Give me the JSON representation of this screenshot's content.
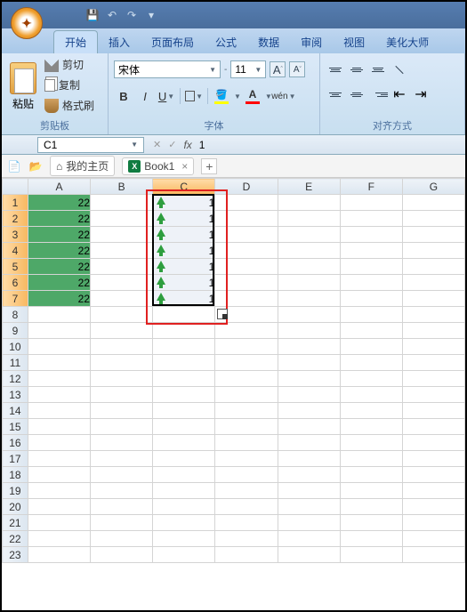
{
  "qat": {
    "save_title": "保存",
    "undo_title": "撤销",
    "redo_title": "重做"
  },
  "tabs": {
    "home": "开始",
    "insert": "插入",
    "layout": "页面布局",
    "formulas": "公式",
    "data": "数据",
    "review": "审阅",
    "view": "视图",
    "beautify": "美化大师"
  },
  "ribbon": {
    "clipboard": {
      "label": "剪贴板",
      "paste": "粘贴",
      "cut": "剪切",
      "copy": "复制",
      "brush": "格式刷"
    },
    "font": {
      "label": "字体",
      "name": "宋体",
      "size": "11",
      "bold": "B",
      "italic": "I",
      "underline": "U",
      "a_grow": "A",
      "a_shrink": "A",
      "wen": "wén"
    },
    "align": {
      "label": "对齐方式"
    }
  },
  "namebox": "C1",
  "formula": "1",
  "doctabs": {
    "home": "我的主页",
    "book": "Book1"
  },
  "columns": [
    "A",
    "B",
    "C",
    "D",
    "E",
    "F",
    "G"
  ],
  "rows": [
    1,
    2,
    3,
    4,
    5,
    6,
    7,
    8,
    9,
    10,
    11,
    12,
    13,
    14,
    15,
    16,
    17,
    18,
    19,
    20,
    21,
    22,
    23
  ],
  "dataA": [
    "22",
    "22",
    "22",
    "22",
    "22",
    "22",
    "22"
  ],
  "dataC": [
    "1",
    "1",
    "1",
    "1",
    "1",
    "1",
    "1"
  ],
  "chart_data": {
    "type": "table",
    "selection": "C1:C7",
    "active_cell": "C1",
    "columns": [
      "A",
      "C"
    ],
    "A": [
      22,
      22,
      22,
      22,
      22,
      22,
      22
    ],
    "C": [
      1,
      1,
      1,
      1,
      1,
      1,
      1
    ],
    "C_icon": "green-up-arrow",
    "A_fill": "#4ea868"
  }
}
